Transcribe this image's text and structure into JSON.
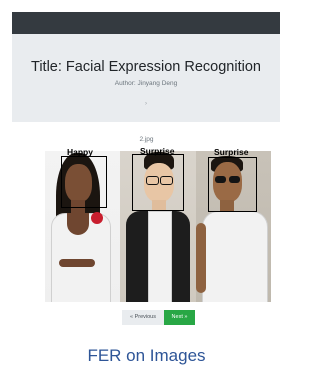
{
  "header": {
    "title": "Title: Facial Expression Recognition",
    "author": "Author: Jinyang Deng",
    "glyph": "›"
  },
  "image": {
    "filename": "2.jpg",
    "faces": [
      {
        "emotion": "Happy"
      },
      {
        "emotion": "Surprise"
      },
      {
        "emotion": "Surprise"
      }
    ]
  },
  "pagination": {
    "previous_label": "« Previous",
    "next_label": "Next »"
  },
  "caption": "FER on Images",
  "colors": {
    "navbar": "#343a40",
    "jumbotron": "#e9ecef",
    "next_button": "#28a745",
    "caption": "#2e5597"
  }
}
